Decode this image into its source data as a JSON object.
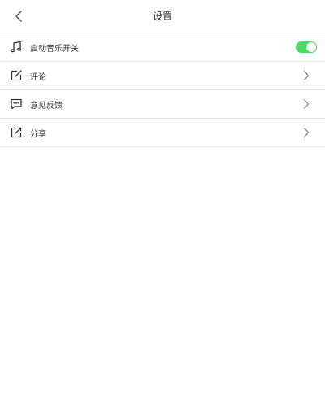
{
  "navbar": {
    "title": "设置",
    "back_icon": "chevron-left-icon"
  },
  "settings": {
    "items": [
      {
        "label": "启动音乐开关",
        "icon": "music-note-icon",
        "control": "toggle",
        "toggle_on": true,
        "toggle_color": "#4cd964"
      },
      {
        "label": "评论",
        "icon": "edit-icon",
        "control": "chevron"
      },
      {
        "label": "意见反馈",
        "icon": "feedback-icon",
        "control": "chevron"
      },
      {
        "label": "分享",
        "icon": "share-icon",
        "control": "chevron"
      }
    ]
  }
}
